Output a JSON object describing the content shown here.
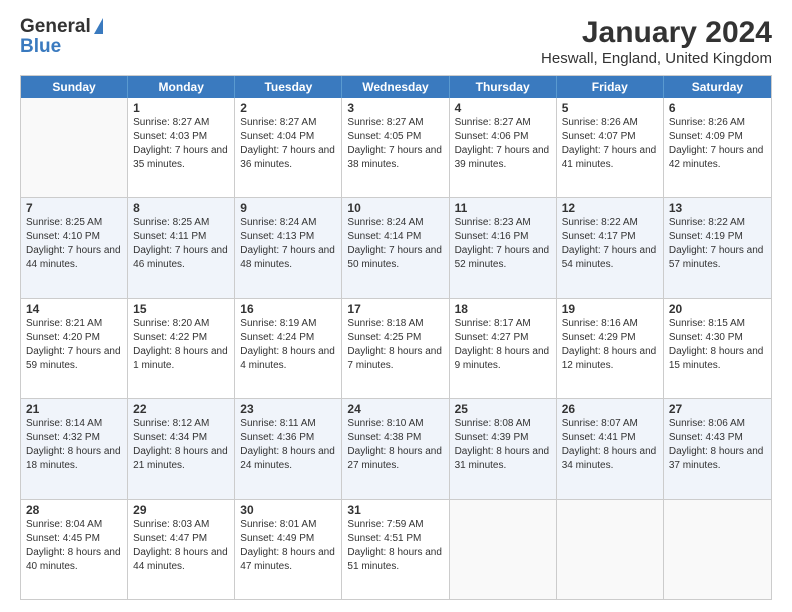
{
  "logo": {
    "line1": "General",
    "line2": "Blue"
  },
  "title": "January 2024",
  "subtitle": "Heswall, England, United Kingdom",
  "days_of_week": [
    "Sunday",
    "Monday",
    "Tuesday",
    "Wednesday",
    "Thursday",
    "Friday",
    "Saturday"
  ],
  "weeks": [
    [
      {
        "day": "",
        "sunrise": "",
        "sunset": "",
        "daylight": "",
        "empty": true
      },
      {
        "day": "1",
        "sunrise": "Sunrise: 8:27 AM",
        "sunset": "Sunset: 4:03 PM",
        "daylight": "Daylight: 7 hours and 35 minutes."
      },
      {
        "day": "2",
        "sunrise": "Sunrise: 8:27 AM",
        "sunset": "Sunset: 4:04 PM",
        "daylight": "Daylight: 7 hours and 36 minutes."
      },
      {
        "day": "3",
        "sunrise": "Sunrise: 8:27 AM",
        "sunset": "Sunset: 4:05 PM",
        "daylight": "Daylight: 7 hours and 38 minutes."
      },
      {
        "day": "4",
        "sunrise": "Sunrise: 8:27 AM",
        "sunset": "Sunset: 4:06 PM",
        "daylight": "Daylight: 7 hours and 39 minutes."
      },
      {
        "day": "5",
        "sunrise": "Sunrise: 8:26 AM",
        "sunset": "Sunset: 4:07 PM",
        "daylight": "Daylight: 7 hours and 41 minutes."
      },
      {
        "day": "6",
        "sunrise": "Sunrise: 8:26 AM",
        "sunset": "Sunset: 4:09 PM",
        "daylight": "Daylight: 7 hours and 42 minutes."
      }
    ],
    [
      {
        "day": "7",
        "sunrise": "Sunrise: 8:25 AM",
        "sunset": "Sunset: 4:10 PM",
        "daylight": "Daylight: 7 hours and 44 minutes."
      },
      {
        "day": "8",
        "sunrise": "Sunrise: 8:25 AM",
        "sunset": "Sunset: 4:11 PM",
        "daylight": "Daylight: 7 hours and 46 minutes."
      },
      {
        "day": "9",
        "sunrise": "Sunrise: 8:24 AM",
        "sunset": "Sunset: 4:13 PM",
        "daylight": "Daylight: 7 hours and 48 minutes."
      },
      {
        "day": "10",
        "sunrise": "Sunrise: 8:24 AM",
        "sunset": "Sunset: 4:14 PM",
        "daylight": "Daylight: 7 hours and 50 minutes."
      },
      {
        "day": "11",
        "sunrise": "Sunrise: 8:23 AM",
        "sunset": "Sunset: 4:16 PM",
        "daylight": "Daylight: 7 hours and 52 minutes."
      },
      {
        "day": "12",
        "sunrise": "Sunrise: 8:22 AM",
        "sunset": "Sunset: 4:17 PM",
        "daylight": "Daylight: 7 hours and 54 minutes."
      },
      {
        "day": "13",
        "sunrise": "Sunrise: 8:22 AM",
        "sunset": "Sunset: 4:19 PM",
        "daylight": "Daylight: 7 hours and 57 minutes."
      }
    ],
    [
      {
        "day": "14",
        "sunrise": "Sunrise: 8:21 AM",
        "sunset": "Sunset: 4:20 PM",
        "daylight": "Daylight: 7 hours and 59 minutes."
      },
      {
        "day": "15",
        "sunrise": "Sunrise: 8:20 AM",
        "sunset": "Sunset: 4:22 PM",
        "daylight": "Daylight: 8 hours and 1 minute."
      },
      {
        "day": "16",
        "sunrise": "Sunrise: 8:19 AM",
        "sunset": "Sunset: 4:24 PM",
        "daylight": "Daylight: 8 hours and 4 minutes."
      },
      {
        "day": "17",
        "sunrise": "Sunrise: 8:18 AM",
        "sunset": "Sunset: 4:25 PM",
        "daylight": "Daylight: 8 hours and 7 minutes."
      },
      {
        "day": "18",
        "sunrise": "Sunrise: 8:17 AM",
        "sunset": "Sunset: 4:27 PM",
        "daylight": "Daylight: 8 hours and 9 minutes."
      },
      {
        "day": "19",
        "sunrise": "Sunrise: 8:16 AM",
        "sunset": "Sunset: 4:29 PM",
        "daylight": "Daylight: 8 hours and 12 minutes."
      },
      {
        "day": "20",
        "sunrise": "Sunrise: 8:15 AM",
        "sunset": "Sunset: 4:30 PM",
        "daylight": "Daylight: 8 hours and 15 minutes."
      }
    ],
    [
      {
        "day": "21",
        "sunrise": "Sunrise: 8:14 AM",
        "sunset": "Sunset: 4:32 PM",
        "daylight": "Daylight: 8 hours and 18 minutes."
      },
      {
        "day": "22",
        "sunrise": "Sunrise: 8:12 AM",
        "sunset": "Sunset: 4:34 PM",
        "daylight": "Daylight: 8 hours and 21 minutes."
      },
      {
        "day": "23",
        "sunrise": "Sunrise: 8:11 AM",
        "sunset": "Sunset: 4:36 PM",
        "daylight": "Daylight: 8 hours and 24 minutes."
      },
      {
        "day": "24",
        "sunrise": "Sunrise: 8:10 AM",
        "sunset": "Sunset: 4:38 PM",
        "daylight": "Daylight: 8 hours and 27 minutes."
      },
      {
        "day": "25",
        "sunrise": "Sunrise: 8:08 AM",
        "sunset": "Sunset: 4:39 PM",
        "daylight": "Daylight: 8 hours and 31 minutes."
      },
      {
        "day": "26",
        "sunrise": "Sunrise: 8:07 AM",
        "sunset": "Sunset: 4:41 PM",
        "daylight": "Daylight: 8 hours and 34 minutes."
      },
      {
        "day": "27",
        "sunrise": "Sunrise: 8:06 AM",
        "sunset": "Sunset: 4:43 PM",
        "daylight": "Daylight: 8 hours and 37 minutes."
      }
    ],
    [
      {
        "day": "28",
        "sunrise": "Sunrise: 8:04 AM",
        "sunset": "Sunset: 4:45 PM",
        "daylight": "Daylight: 8 hours and 40 minutes."
      },
      {
        "day": "29",
        "sunrise": "Sunrise: 8:03 AM",
        "sunset": "Sunset: 4:47 PM",
        "daylight": "Daylight: 8 hours and 44 minutes."
      },
      {
        "day": "30",
        "sunrise": "Sunrise: 8:01 AM",
        "sunset": "Sunset: 4:49 PM",
        "daylight": "Daylight: 8 hours and 47 minutes."
      },
      {
        "day": "31",
        "sunrise": "Sunrise: 7:59 AM",
        "sunset": "Sunset: 4:51 PM",
        "daylight": "Daylight: 8 hours and 51 minutes."
      },
      {
        "day": "",
        "sunrise": "",
        "sunset": "",
        "daylight": "",
        "empty": true
      },
      {
        "day": "",
        "sunrise": "",
        "sunset": "",
        "daylight": "",
        "empty": true
      },
      {
        "day": "",
        "sunrise": "",
        "sunset": "",
        "daylight": "",
        "empty": true
      }
    ]
  ]
}
